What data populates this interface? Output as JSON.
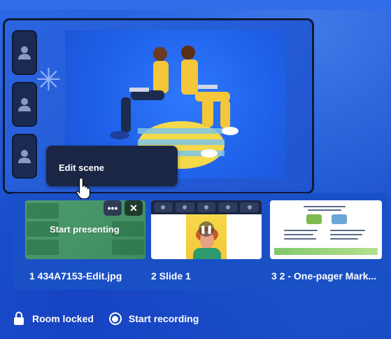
{
  "tooltip": {
    "label": "Edit scene"
  },
  "slides": [
    {
      "label": "1 434A7153-Edit.jpg",
      "overlay": "Start presenting"
    },
    {
      "label": "2 Slide 1"
    },
    {
      "label": "3 2 - One-pager Mark..."
    }
  ],
  "thumb_buttons": {
    "more": "•••",
    "close": "✕"
  },
  "bottom_bar": {
    "room_locked": "Room locked",
    "start_recording": "Start recording"
  },
  "colors": {
    "background": "#1f5ad6",
    "panel": "#1a2a52",
    "tooltip": "#1b2644",
    "presenting_thumb": "#4e9b6f"
  },
  "icons": [
    "avatar-icon",
    "cursor-hand-icon",
    "more-icon",
    "close-icon",
    "pause-icon",
    "lock-icon",
    "record-icon"
  ]
}
